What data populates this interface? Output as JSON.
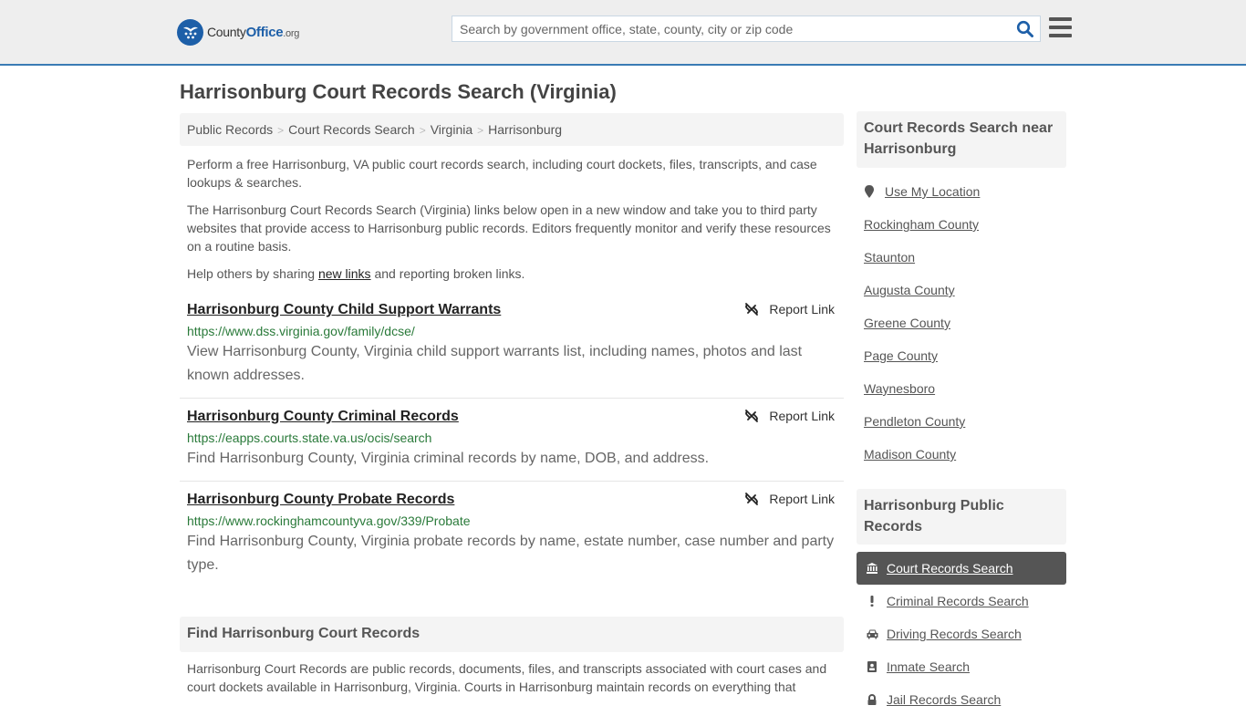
{
  "header": {
    "logo": {
      "county": "County",
      "office": "Office",
      "org": ".org"
    },
    "search_placeholder": "Search by government office, state, county, city or zip code",
    "colors": {
      "brand": "#1d5fa8",
      "accent_border": "#3a7bb4"
    }
  },
  "page_title": "Harrisonburg Court Records Search (Virginia)",
  "breadcrumb": [
    "Public Records",
    "Court Records Search",
    "Virginia",
    "Harrisonburg"
  ],
  "intro": {
    "p1": "Perform a free Harrisonburg, VA public court records search, including court dockets, files, transcripts, and case lookups & searches.",
    "p2": "The Harrisonburg Court Records Search (Virginia) links below open in a new window and take you to third party websites that provide access to Harrisonburg public records. Editors frequently monitor and verify these resources on a routine basis.",
    "p3_before": "Help others by sharing ",
    "p3_link": "new links",
    "p3_after": " and reporting broken links."
  },
  "results": [
    {
      "title": "Harrisonburg County Child Support Warrants",
      "url": "https://www.dss.virginia.gov/family/dcse/",
      "description": "View Harrisonburg County, Virginia child support warrants list, including names, photos and last known addresses.",
      "report_label": "Report Link"
    },
    {
      "title": "Harrisonburg County Criminal Records",
      "url": "https://eapps.courts.state.va.us/ocis/search",
      "description": "Find Harrisonburg County, Virginia criminal records by name, DOB, and address.",
      "report_label": "Report Link"
    },
    {
      "title": "Harrisonburg County Probate Records",
      "url": "https://www.rockinghamcountyva.gov/339/Probate",
      "description": "Find Harrisonburg County, Virginia probate records by name, estate number, case number and party type.",
      "report_label": "Report Link"
    }
  ],
  "find_section": {
    "heading": "Find Harrisonburg Court Records",
    "body": "Harrisonburg Court Records are public records, documents, files, and transcripts associated with court cases and court dockets available in Harrisonburg, Virginia. Courts in Harrisonburg maintain records on everything that"
  },
  "sidebar": {
    "nearby_heading": "Court Records Search near Harrisonburg",
    "use_location": "Use My Location",
    "nearby": [
      "Rockingham County",
      "Staunton",
      "Augusta County",
      "Greene County",
      "Page County",
      "Waynesboro",
      "Pendleton County",
      "Madison County"
    ],
    "public_records_heading": "Harrisonburg Public Records",
    "public_records": [
      {
        "label": "Court Records Search",
        "icon": "courthouse-icon",
        "active": true
      },
      {
        "label": "Criminal Records Search",
        "icon": "exclamation-icon",
        "active": false
      },
      {
        "label": "Driving Records Search",
        "icon": "car-icon",
        "active": false
      },
      {
        "label": "Inmate Search",
        "icon": "id-badge-icon",
        "active": false
      },
      {
        "label": "Jail Records Search",
        "icon": "lock-icon",
        "active": false
      }
    ]
  }
}
